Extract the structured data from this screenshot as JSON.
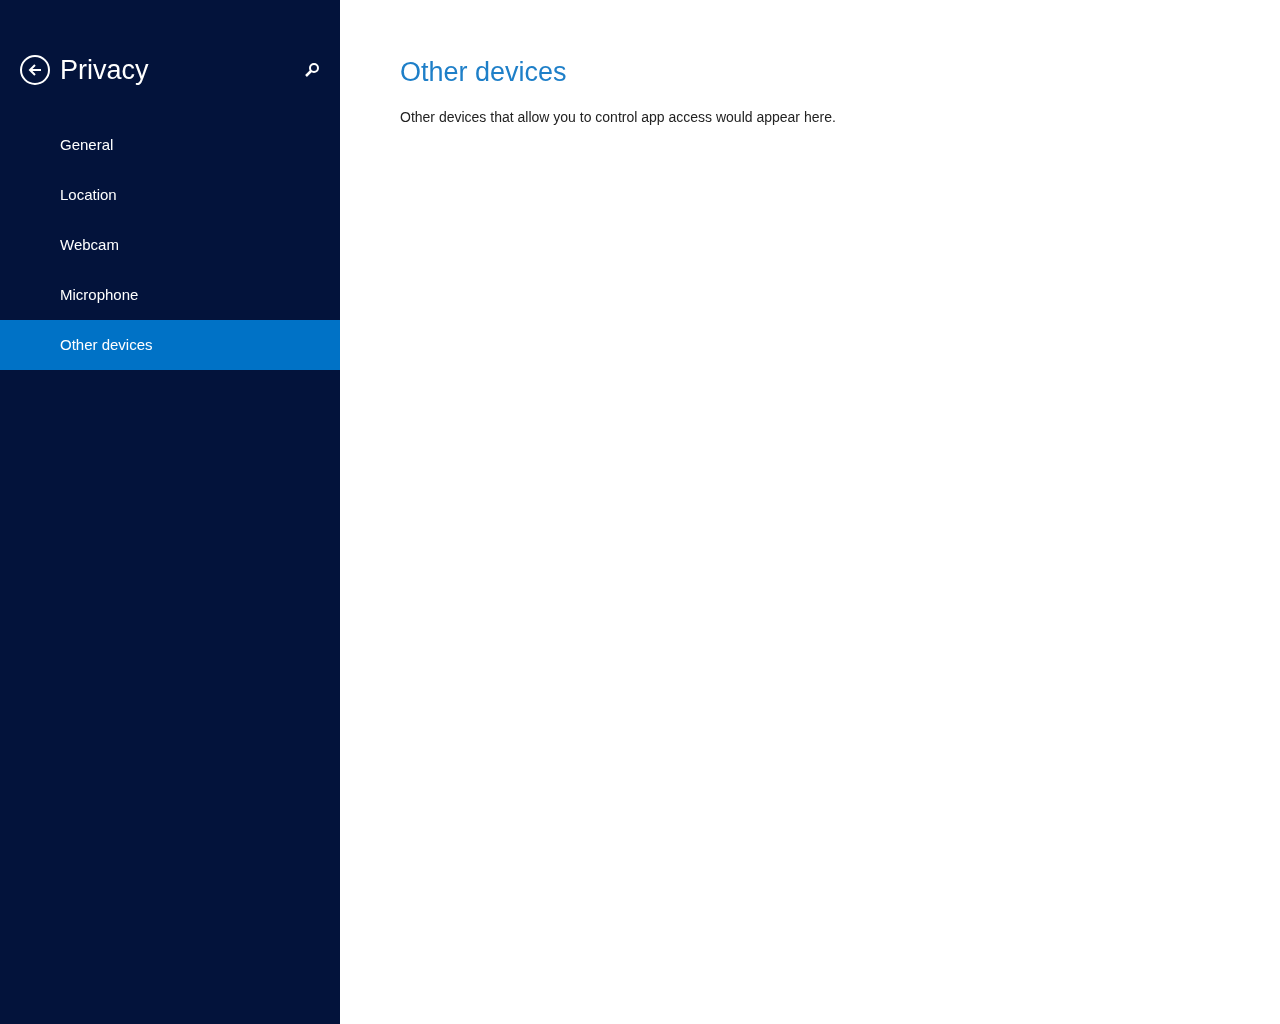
{
  "sidebar": {
    "title": "Privacy",
    "items": [
      {
        "label": "General",
        "selected": false
      },
      {
        "label": "Location",
        "selected": false
      },
      {
        "label": "Webcam",
        "selected": false
      },
      {
        "label": "Microphone",
        "selected": false
      },
      {
        "label": "Other devices",
        "selected": true
      }
    ]
  },
  "content": {
    "heading": "Other devices",
    "description": "Other devices that allow you to control app access would appear here."
  }
}
